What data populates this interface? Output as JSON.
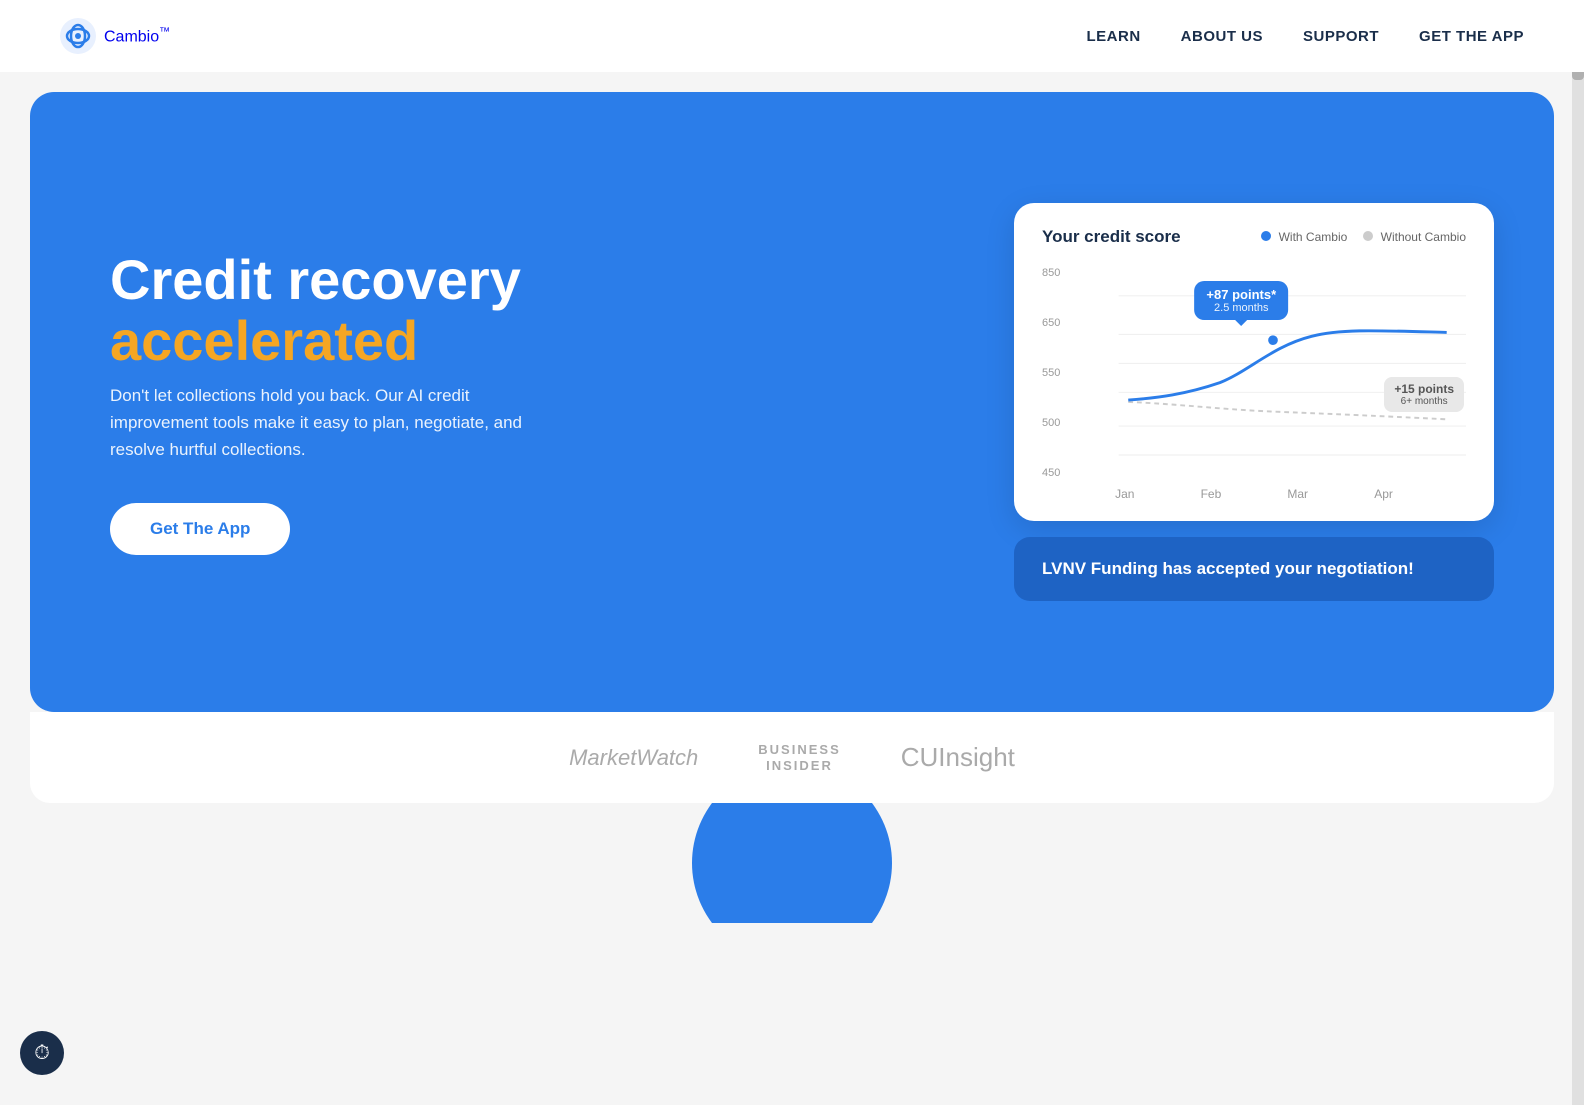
{
  "navbar": {
    "logo_text": "Cambio",
    "logo_tm": "™",
    "nav_items": [
      {
        "label": "LEARN",
        "href": "#"
      },
      {
        "label": "ABOUT US",
        "href": "#"
      },
      {
        "label": "SUPPORT",
        "href": "#"
      },
      {
        "label": "GET THE APP",
        "href": "#"
      }
    ]
  },
  "hero": {
    "title_line1": "Credit recovery",
    "title_line2": "accelerated",
    "subtitle": "Don't let collections hold you back. Our AI credit improvement tools make it easy to plan, negotiate, and resolve hurtful collections.",
    "cta_label": "Get The App"
  },
  "chart": {
    "title": "Your credit score",
    "legend_with": "With Cambio",
    "legend_without": "Without Cambio",
    "tooltip_blue_main": "+87 points*",
    "tooltip_blue_sub": "2.5 months",
    "tooltip_gray_main": "+15 points",
    "tooltip_gray_sub": "6+ months",
    "y_labels": [
      "850",
      "650",
      "550",
      "500",
      "450"
    ],
    "x_labels": [
      "Jan",
      "Feb",
      "Mar",
      "Apr"
    ]
  },
  "negotiation": {
    "text": "LVNV Funding has accepted your negotiation!"
  },
  "press": {
    "logos": [
      {
        "name": "MarketWatch",
        "style": "mw"
      },
      {
        "name": "BUSINESS\nINSIDER",
        "style": "bi"
      },
      {
        "name": "CUInsight",
        "style": "cui"
      }
    ]
  },
  "accessibility": {
    "icon": "⏱"
  }
}
